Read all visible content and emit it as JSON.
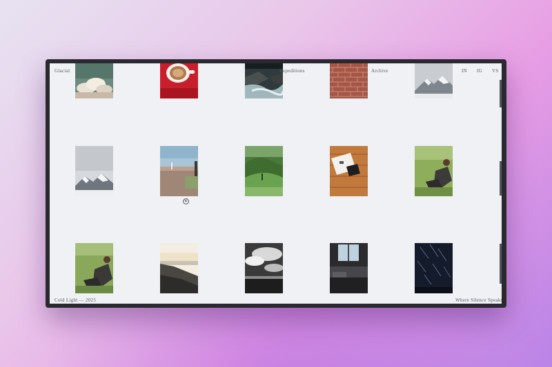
{
  "site": {
    "logo": "Glacial",
    "nav_left": "Expeditions",
    "nav_right": "Archive",
    "socials": [
      "IN",
      "IG",
      "VS"
    ]
  },
  "footer": {
    "left": "Cold Light — 2025",
    "right": "Where Silence Speaks"
  },
  "gallery": {
    "rows": [
      [
        "clouds-photo",
        "coffee-cup-photo",
        "river-rocks-photo",
        "brick-wall-photo",
        "snowy-peak-photo"
      ],
      [
        "snowy-mountain-photo",
        "lighthouse-field-photo",
        "green-hills-photo",
        "book-on-desk-photo",
        "grass-hiker-photo"
      ],
      [
        "grass-hiker-photo",
        "sunset-cliff-photo",
        "bw-sky-photo",
        "window-room-photo",
        "star-trails-photo"
      ]
    ]
  },
  "cursor": "hand-pointer-icon"
}
